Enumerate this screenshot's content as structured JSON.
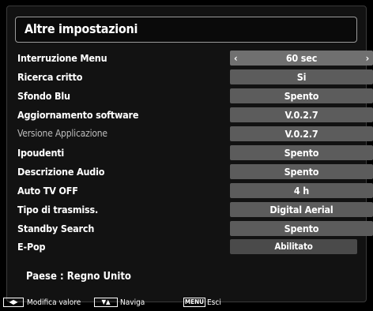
{
  "title": "Altre impostazioni",
  "rows": [
    {
      "label": "Interruzione Menu",
      "value": "60 sec",
      "prev_icon": "‹",
      "next_icon": "›"
    },
    {
      "label": "Ricerca critto",
      "value": "Si"
    },
    {
      "label": "Sfondo Blu",
      "value": "Spento"
    },
    {
      "label": "Aggiornamento software",
      "value": "V.0.2.7"
    },
    {
      "label": "Versione Applicazione",
      "value": "V.0.2.7"
    },
    {
      "label": "Ipoudenti",
      "value": "Spento"
    },
    {
      "label": "Descrizione Audio",
      "value": "Spento"
    },
    {
      "label": "Auto TV OFF",
      "value": "4 h"
    },
    {
      "label": "Tipo di trasmiss.",
      "value": "Digital Aerial"
    },
    {
      "label": "Standby Search",
      "value": "Spento"
    }
  ],
  "epop": {
    "label": "E-Pop",
    "value": "Abilitato"
  },
  "country": "Paese : Regno Unito",
  "footer": {
    "lr_keys": "◀▶",
    "modify": "Modifica valore",
    "ud_keys": "▼▲",
    "navigate": "Naviga",
    "menu_key": "MENU",
    "exit": "Esci"
  }
}
